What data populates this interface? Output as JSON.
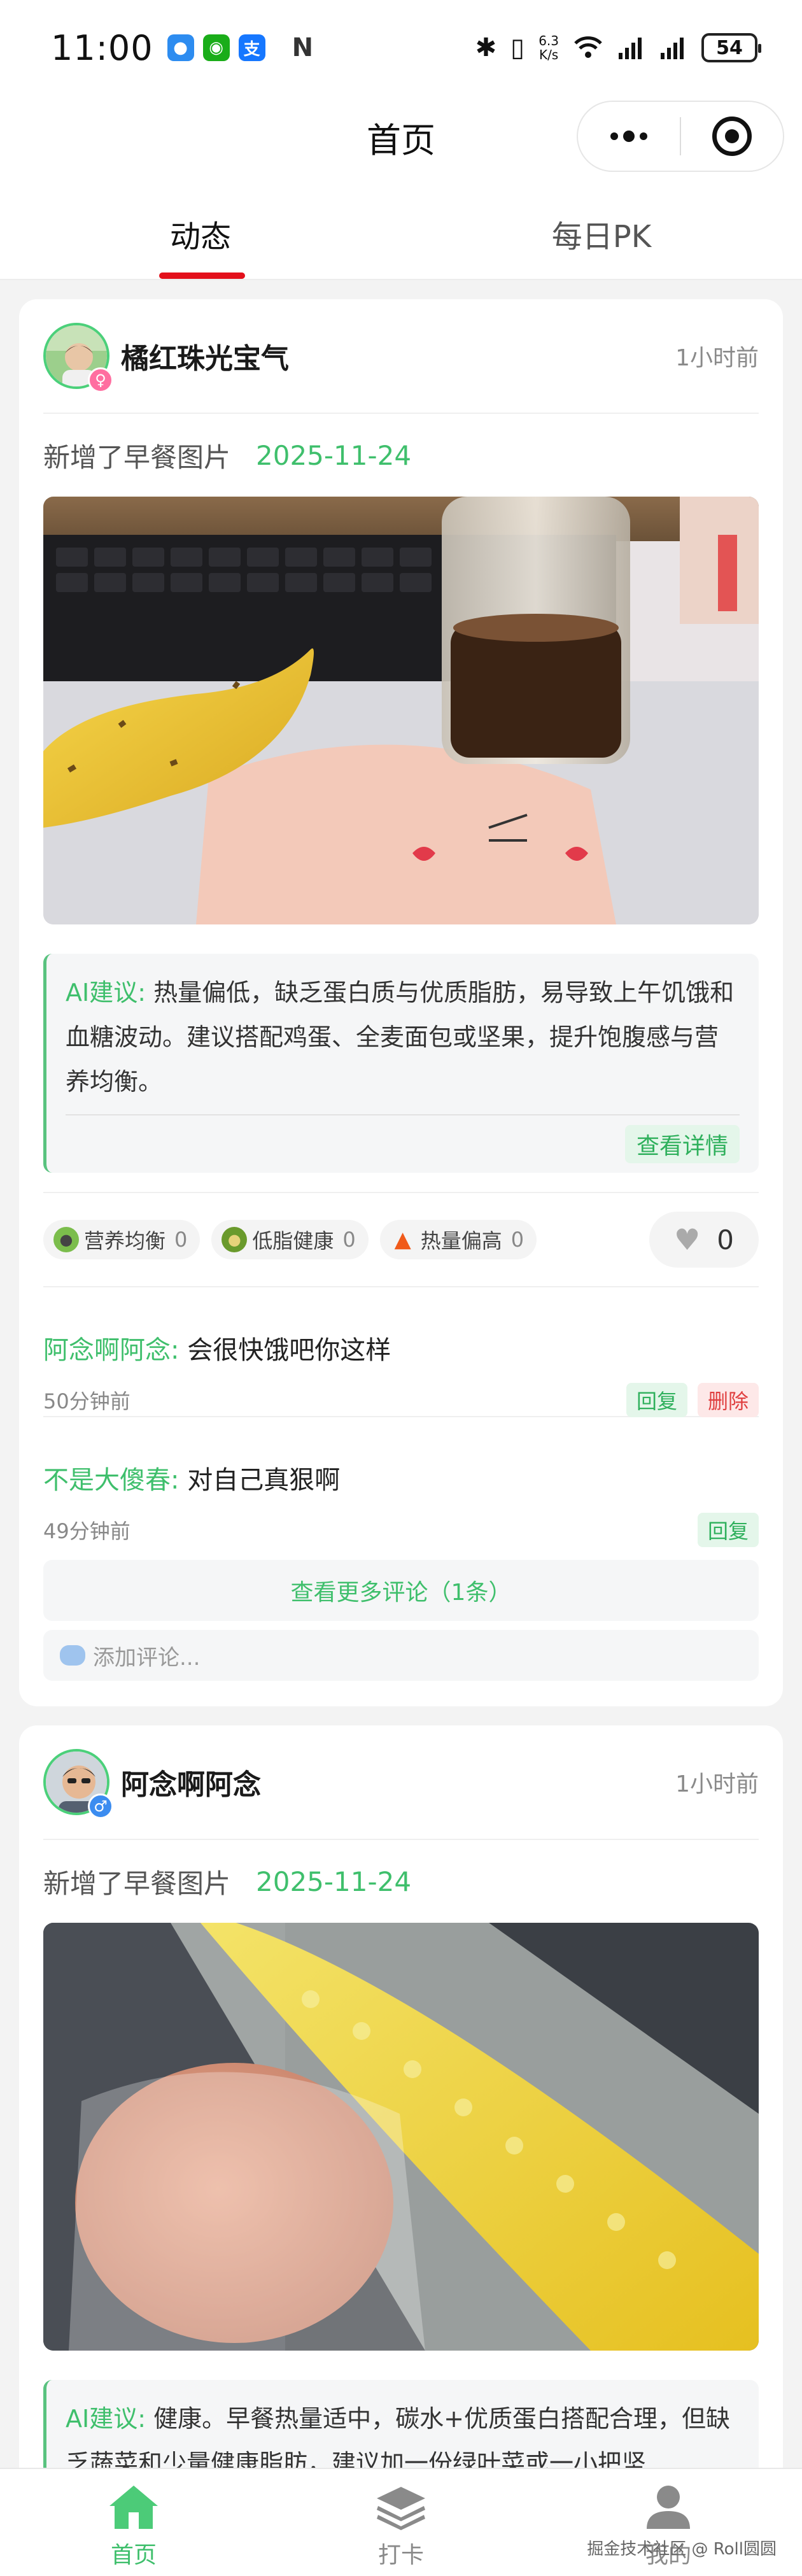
{
  "status_bar": {
    "time": "11:00",
    "net_speed_value": "6.3",
    "net_speed_unit": "K/s",
    "battery": "54",
    "icons": [
      "message-app-icon",
      "wechat-icon",
      "alipay-icon",
      "nfc-icon",
      "bluetooth-icon",
      "vibrate-icon",
      "wifi-icon",
      "signal-icon",
      "signal-icon-2",
      "battery-icon"
    ]
  },
  "navbar": {
    "title": "首页"
  },
  "tabs": [
    {
      "label": "动态",
      "active": true
    },
    {
      "label": "每日PK",
      "active": false
    }
  ],
  "posts": [
    {
      "user": "橘红珠光宝气",
      "gender": "female",
      "time_ago": "1小时前",
      "action": "新增了早餐图片",
      "date": "2025-11-24",
      "ai_label": "AI建议:",
      "ai_text": "热量偏低，缺乏蛋白质与优质脂肪，易导致上午饥饿和血糖波动。建议搭配鸡蛋、全麦面包或坚果，提升饱腹感与营养均衡。",
      "ai_more": "查看详情",
      "tags": [
        {
          "label": "营养均衡",
          "count": "0",
          "icon": "salad-icon"
        },
        {
          "label": "低脂健康",
          "count": "0",
          "icon": "avocado-icon"
        },
        {
          "label": "热量偏高",
          "count": "0",
          "icon": "fire-icon"
        }
      ],
      "likes": "0",
      "comments": [
        {
          "author": "阿念啊阿念:",
          "text": "会很快饿吧你这样",
          "time": "50分钟前",
          "reply": "回复",
          "delete": "删除"
        },
        {
          "author": "不是大傻春:",
          "text": "对自己真狠啊",
          "time": "49分钟前",
          "reply": "回复"
        }
      ],
      "more_comments": "查看更多评论（1条）",
      "add_comment_placeholder": "添加评论..."
    },
    {
      "user": "阿念啊阿念",
      "gender": "male",
      "time_ago": "1小时前",
      "action": "新增了早餐图片",
      "date": "2025-11-24",
      "ai_label": "AI建议:",
      "ai_text": "健康。早餐热量适中，碳水+优质蛋白搭配合理，但缺乏蔬菜和少量健康脂肪，建议加一份绿叶菜或一小把坚"
    }
  ],
  "tabbar": [
    {
      "label": "首页",
      "icon": "home-icon",
      "active": true
    },
    {
      "label": "打卡",
      "icon": "layers-icon",
      "active": false
    },
    {
      "label": "我的",
      "icon": "user-icon",
      "active": false
    }
  ],
  "watermark": "掘金技术社区 @ Roll圆圆",
  "colors": {
    "accent_green": "#3fbf6c",
    "tab_indicator_red": "#e3101b",
    "delete_red": "#e04040"
  }
}
